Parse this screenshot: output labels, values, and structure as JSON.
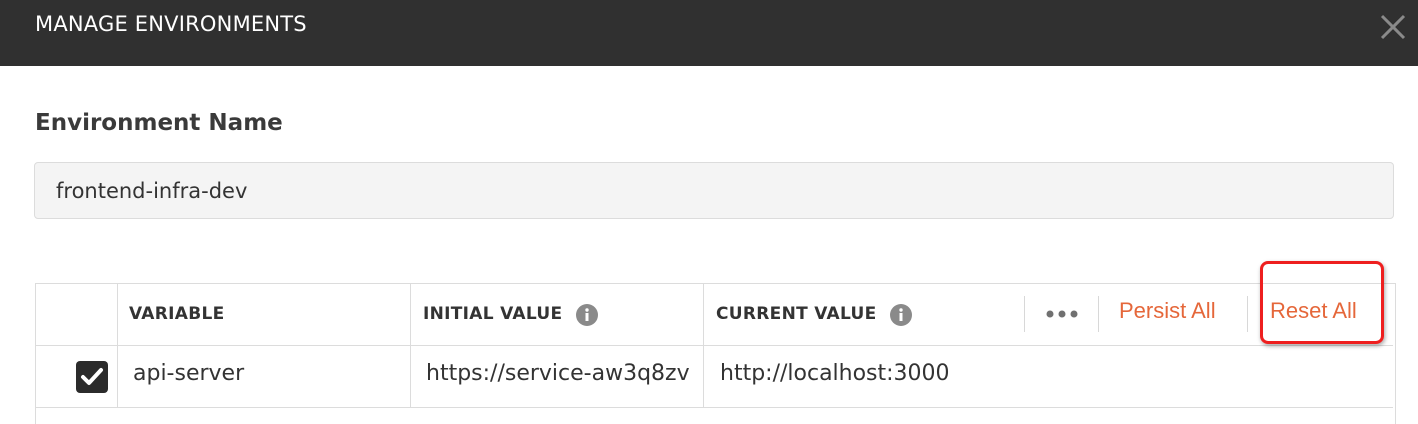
{
  "modal": {
    "title": "MANAGE ENVIRONMENTS",
    "close_icon": "close-icon"
  },
  "environment": {
    "label": "Environment Name",
    "name_value": "frontend-infra-dev"
  },
  "table": {
    "headers": {
      "variable": "VARIABLE",
      "initial_value": "INITIAL VALUE",
      "current_value": "CURRENT VALUE"
    },
    "actions": {
      "more_icon": "more-horizontal-icon",
      "persist_all": "Persist All",
      "reset_all": "Reset All"
    },
    "rows": [
      {
        "enabled": true,
        "variable": "api-server",
        "initial_value": "https://service-aw3q8zv",
        "current_value": "http://localhost:3000"
      }
    ]
  },
  "colors": {
    "titlebar": "#303030",
    "accent": "#e5673a",
    "highlight": "#ee1f1f"
  }
}
